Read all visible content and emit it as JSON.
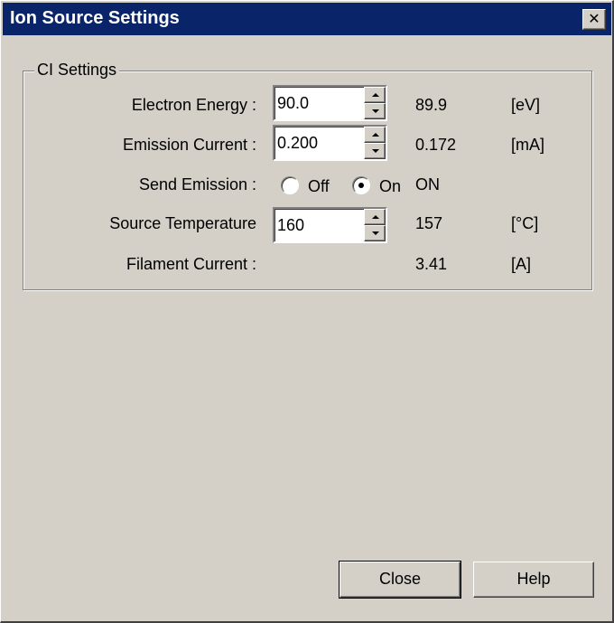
{
  "window": {
    "title": "Ion Source Settings",
    "close_glyph": "✕"
  },
  "group": {
    "legend": "CI Settings"
  },
  "rows": {
    "electron_energy": {
      "label": "Electron Energy :",
      "setpoint": "90.0",
      "readback": "89.9",
      "unit": "[eV]"
    },
    "emission_current": {
      "label": "Emission Current :",
      "setpoint": "0.200",
      "readback": "0.172",
      "unit": "[mA]"
    },
    "send_emission": {
      "label": "Send Emission :",
      "off_label": "Off",
      "on_label": "On",
      "selected": "On",
      "readback": "ON"
    },
    "source_temperature": {
      "label": "Source Temperature",
      "setpoint": "160",
      "readback": "157",
      "unit": "[°C]"
    },
    "filament_current": {
      "label": "Filament Current :",
      "readback": "3.41",
      "unit": "[A]"
    }
  },
  "buttons": {
    "close_label": "Close",
    "help_label": "Help"
  },
  "colors": {
    "titlebar": "#0a246a",
    "face": "#d4d0c8"
  }
}
